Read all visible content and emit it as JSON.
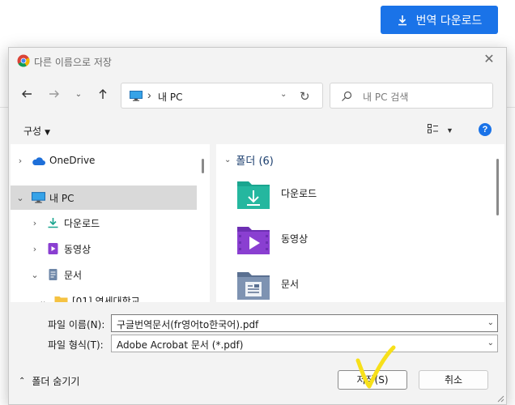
{
  "background": {
    "translate_download_label": "번역 다운로드",
    "accent_color": "#1a73e8"
  },
  "dialog": {
    "title": "다른 이름으로 저장",
    "address": {
      "location": "내 PC",
      "back_icon": "arrow-left-icon",
      "forward_icon": "arrow-right-icon",
      "up_icon": "arrow-up-icon",
      "refresh_icon": "refresh-icon"
    },
    "search": {
      "placeholder": "내 PC 검색"
    },
    "toolbar": {
      "organize_label": "구성",
      "view_icon": "view-options-icon",
      "help_label": "?"
    },
    "nav_tree": [
      {
        "label": "OneDrive",
        "icon": "cloud-icon",
        "expander": "›"
      },
      {
        "label": "내 PC",
        "icon": "pc-icon",
        "expander": "⌄",
        "selected": true
      },
      {
        "label": "다운로드",
        "icon": "download-icon",
        "expander": "›"
      },
      {
        "label": "동영상",
        "icon": "video-icon",
        "expander": "›"
      },
      {
        "label": "문서",
        "icon": "document-icon",
        "expander": "⌄"
      },
      {
        "label": "[01] 연세대학교",
        "icon": "folder-icon",
        "expander": "⌄"
      }
    ],
    "content": {
      "group_title": "폴더 (6)",
      "folders": [
        {
          "name": "다운로드",
          "icon": "downloads-folder-icon"
        },
        {
          "name": "동영상",
          "icon": "videos-folder-icon"
        },
        {
          "name": "문서",
          "icon": "documents-folder-icon"
        }
      ]
    },
    "form": {
      "filename_label": "파일 이름(N):",
      "filename_value": "구글번역문서(fr영어to한국어).pdf",
      "filetype_label": "파일 형식(T):",
      "filetype_value": "Adobe Acrobat 문서 (*.pdf)"
    },
    "footer": {
      "hide_folders_label": "폴더 숨기기",
      "save_label": "저장(S)",
      "cancel_label": "취소"
    }
  }
}
